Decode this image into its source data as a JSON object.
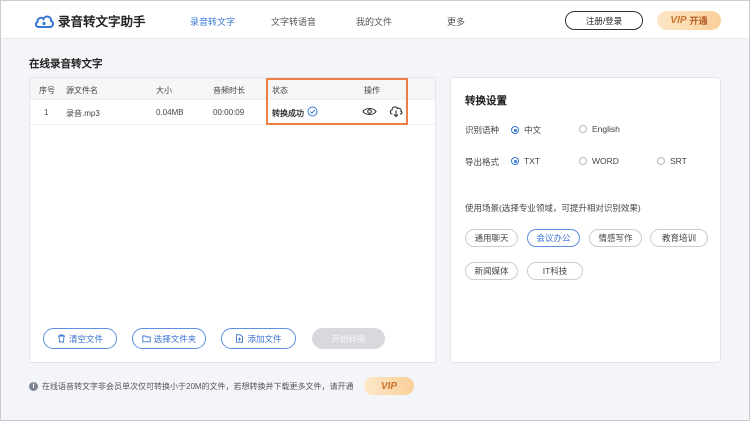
{
  "header": {
    "app_name": "录音转文字助手",
    "nav": [
      "录音转文字",
      "文字转语音",
      "我的文件",
      "更多"
    ],
    "register_label": "注册/登录",
    "vip_label": "VIP",
    "vip_open_label": "开通"
  },
  "page_title": "在线录音转文字",
  "table": {
    "columns": [
      "序号",
      "源文件名",
      "大小",
      "音频时长",
      "状态",
      "操作"
    ],
    "rows": [
      {
        "index": "1",
        "filename": "录音.mp3",
        "size": "0.04MB",
        "duration": "00:00:09",
        "status": "转换成功"
      }
    ]
  },
  "actions": {
    "clear": "清空文件",
    "choose_folder": "选择文件夹",
    "add_file": "添加文件",
    "start": "开始转换"
  },
  "settings": {
    "title": "转换设置",
    "language_label": "识别语种",
    "languages": [
      "中文",
      "English"
    ],
    "language_selected": "中文",
    "format_label": "导出格式",
    "formats": [
      "TXT",
      "WORD",
      "SRT"
    ],
    "format_selected": "TXT",
    "scene_label": "使用场景(选择专业领域，可提升相对识别效果)",
    "scenes": [
      "通用聊天",
      "会议办公",
      "情感写作",
      "教育培训",
      "新闻媒体",
      "IT科技"
    ],
    "scene_selected": "会议办公"
  },
  "notice": {
    "text": "在线语音转文字非会员单次仅可转换小于20M的文件，若想转换并下载更多文件，请开通",
    "vip_label": "VIP"
  },
  "colors": {
    "accent": "#3a78d6",
    "highlight_box": "#ef7d46",
    "vip_gold": "#f9cf98"
  }
}
